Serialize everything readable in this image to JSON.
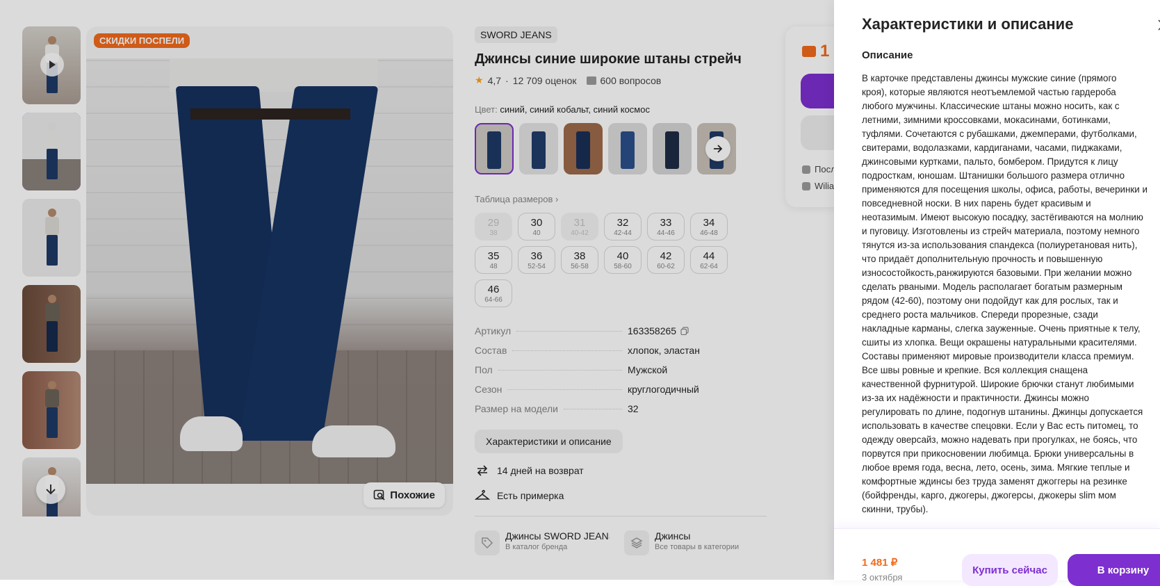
{
  "product": {
    "sale_badge": "СКИДКИ ПОСПЕЛИ",
    "similar_label": "Похожие",
    "brand": "SWORD JEANS",
    "title": "Джинсы синие широкие штаны стрейч",
    "rating": "4,7",
    "reviews": "12 709 оценок",
    "questions": "600 вопросов",
    "color_label": "Цвет:",
    "color_value": "синий, синий кобальт, синий космос",
    "size_table_label": "Таблица размеров",
    "sizes": [
      {
        "n": "29",
        "r": "38",
        "disabled": true
      },
      {
        "n": "30",
        "r": "40",
        "disabled": false
      },
      {
        "n": "31",
        "r": "40-42",
        "disabled": true
      },
      {
        "n": "32",
        "r": "42-44",
        "disabled": false
      },
      {
        "n": "33",
        "r": "44-46",
        "disabled": false
      },
      {
        "n": "34",
        "r": "46-48",
        "disabled": false
      },
      {
        "n": "35",
        "r": "48",
        "disabled": false
      },
      {
        "n": "36",
        "r": "52-54",
        "disabled": false
      },
      {
        "n": "38",
        "r": "56-58",
        "disabled": false
      },
      {
        "n": "40",
        "r": "58-60",
        "disabled": false
      },
      {
        "n": "42",
        "r": "60-62",
        "disabled": false
      },
      {
        "n": "44",
        "r": "62-64",
        "disabled": false
      },
      {
        "n": "46",
        "r": "64-66",
        "disabled": false
      }
    ],
    "specs": [
      {
        "k": "Артикул",
        "v": "163358265"
      },
      {
        "k": "Состав",
        "v": "хлопок, эластан"
      },
      {
        "k": "Пол",
        "v": "Мужской"
      },
      {
        "k": "Сезон",
        "v": "круглогодичный"
      },
      {
        "k": "Размер на модели",
        "v": "32"
      }
    ],
    "char_button": "Характеристики и описание",
    "perks": [
      "14 дней на возврат",
      "Есть примерка"
    ],
    "brand_link_title": "Джинсы SWORD JEANS",
    "brand_link_sub": "В каталог бренда",
    "category_link_title": "Джинсы",
    "category_link_sub": "Все товары в категории"
  },
  "buy_card": {
    "price": "1",
    "line1": "Посл",
    "line2": "Wilia"
  },
  "drawer": {
    "title": "Характеристики и описание",
    "subtitle": "Описание",
    "description": "В карточке представлены джинсы мужские синие (прямого\nкроя), которые являются неотъемлемой частью гардероба\nлюбого мужчины. Классические штаны можно носить, как с\nлетними, зимними кроссовками, мокасинами, ботинками,\nтуфлями. Сочетаются с рубашками, джемперами, футболками,\nсвитерами, водолазками, кардиганами, часами, пиджаками,\nджинсовыми куртками, пальто, бомбером. Придутся к лицу\nподросткам, юношам. Штанишки большого размера отлично\nприменяются для посещения школы, офиса, работы, вечеринки и\nповседневной носки. В них парень будет красивым и\nнеотазимым. Имеют высокую посадку, застёгиваются на молнию\nи пуговицу. Изготовлены из стрейч материала, поэтому немного\nтянутся из-за использования спандекса (полиуретановая нить),\nчто придаёт дополнительную прочность и повышенную\nизносостойкость,ранжируются базовыми. При желании можно\nсделать рваными. Модель располагает богатым размерным\nрядом (42-60), поэтому они подойдут как для рослых, так и\nсреднего роста мальчиков. Спереди прорезные, сзади\nнакладные карманы, слегка зауженные. Очень приятные к телу,\nсшиты из хлопка. Вещи окрашены натуральными красителями.\nСоставы применяют мировые производители класса премиум.\nВсе швы ровные и крепкие. Вся коллекция снащена\nкачественной фурнитурой. Широкие брючки станут любимыми\nиз-за их надёжности и практичности. Джинсы можно\nрегулировать по длине, подогнув штанины. Джинцы допускается\nиспользовать в качестве спецовки. Если у Вас есть питомец, то\nодежду оверсайз, можно надевать при прогулках, не боясь, что\nпорвутся при прикосновении любимца. Брюки универсальны в\nлюбое время года, весна, лето, осень, зима. Мягкие теплые и\nкомфортные ждинсы без труда заменят джоггеры на резинке\n(бойфренды, карго, джогеры, джогерсы, джокеры slim мом\nскинни, трубы).",
    "price": "1 481 ₽",
    "date": "3 октября",
    "buy_now": "Купить сейчас",
    "to_cart": "В корзину"
  },
  "colors": {
    "accent": "#7d2fd0",
    "price": "#f26b1d",
    "sale": "#f26b1d"
  }
}
